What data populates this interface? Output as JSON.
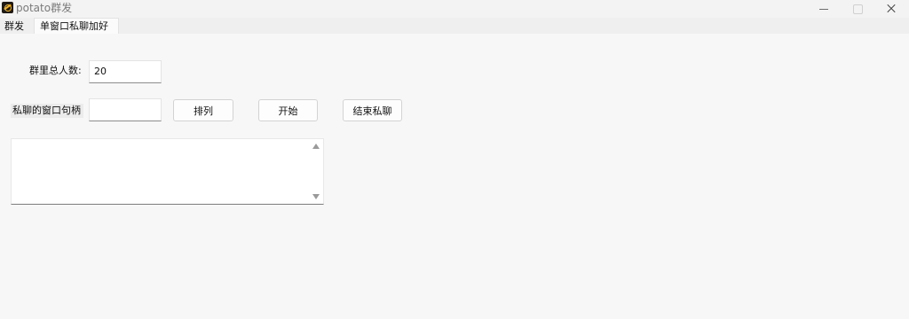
{
  "window": {
    "title": "potato群发",
    "controls": {
      "minimize": "minimize",
      "maximize": "maximize",
      "close": "close"
    }
  },
  "tabs": [
    {
      "label": "群发",
      "selected": false
    },
    {
      "label": "单窗口私聊加好友",
      "selected": true
    }
  ],
  "form": {
    "group_count_label": "群里总人数:",
    "group_count_value": "20",
    "chat_handle_label": "私聊的窗口句柄",
    "chat_handle_value": ""
  },
  "buttons": {
    "arrange": "排列",
    "start": "开始",
    "end_chat": "结束私聊"
  },
  "log": {
    "text": ""
  },
  "icons": {
    "app": "potato-icon",
    "scroll_up": "arrow-up-icon",
    "scroll_down": "arrow-down-icon"
  }
}
